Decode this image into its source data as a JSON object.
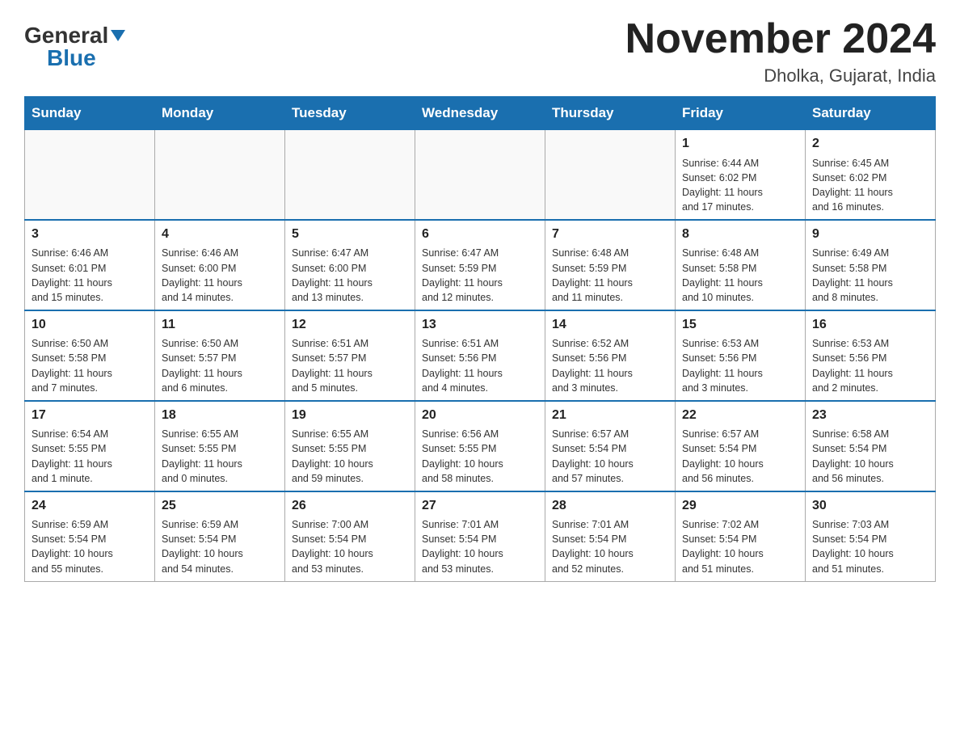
{
  "header": {
    "logo_text_general": "General",
    "logo_text_blue": "Blue",
    "month_title": "November 2024",
    "location": "Dholka, Gujarat, India"
  },
  "weekdays": [
    "Sunday",
    "Monday",
    "Tuesday",
    "Wednesday",
    "Thursday",
    "Friday",
    "Saturday"
  ],
  "weeks": [
    [
      {
        "day": "",
        "info": ""
      },
      {
        "day": "",
        "info": ""
      },
      {
        "day": "",
        "info": ""
      },
      {
        "day": "",
        "info": ""
      },
      {
        "day": "",
        "info": ""
      },
      {
        "day": "1",
        "info": "Sunrise: 6:44 AM\nSunset: 6:02 PM\nDaylight: 11 hours\nand 17 minutes."
      },
      {
        "day": "2",
        "info": "Sunrise: 6:45 AM\nSunset: 6:02 PM\nDaylight: 11 hours\nand 16 minutes."
      }
    ],
    [
      {
        "day": "3",
        "info": "Sunrise: 6:46 AM\nSunset: 6:01 PM\nDaylight: 11 hours\nand 15 minutes."
      },
      {
        "day": "4",
        "info": "Sunrise: 6:46 AM\nSunset: 6:00 PM\nDaylight: 11 hours\nand 14 minutes."
      },
      {
        "day": "5",
        "info": "Sunrise: 6:47 AM\nSunset: 6:00 PM\nDaylight: 11 hours\nand 13 minutes."
      },
      {
        "day": "6",
        "info": "Sunrise: 6:47 AM\nSunset: 5:59 PM\nDaylight: 11 hours\nand 12 minutes."
      },
      {
        "day": "7",
        "info": "Sunrise: 6:48 AM\nSunset: 5:59 PM\nDaylight: 11 hours\nand 11 minutes."
      },
      {
        "day": "8",
        "info": "Sunrise: 6:48 AM\nSunset: 5:58 PM\nDaylight: 11 hours\nand 10 minutes."
      },
      {
        "day": "9",
        "info": "Sunrise: 6:49 AM\nSunset: 5:58 PM\nDaylight: 11 hours\nand 8 minutes."
      }
    ],
    [
      {
        "day": "10",
        "info": "Sunrise: 6:50 AM\nSunset: 5:58 PM\nDaylight: 11 hours\nand 7 minutes."
      },
      {
        "day": "11",
        "info": "Sunrise: 6:50 AM\nSunset: 5:57 PM\nDaylight: 11 hours\nand 6 minutes."
      },
      {
        "day": "12",
        "info": "Sunrise: 6:51 AM\nSunset: 5:57 PM\nDaylight: 11 hours\nand 5 minutes."
      },
      {
        "day": "13",
        "info": "Sunrise: 6:51 AM\nSunset: 5:56 PM\nDaylight: 11 hours\nand 4 minutes."
      },
      {
        "day": "14",
        "info": "Sunrise: 6:52 AM\nSunset: 5:56 PM\nDaylight: 11 hours\nand 3 minutes."
      },
      {
        "day": "15",
        "info": "Sunrise: 6:53 AM\nSunset: 5:56 PM\nDaylight: 11 hours\nand 3 minutes."
      },
      {
        "day": "16",
        "info": "Sunrise: 6:53 AM\nSunset: 5:56 PM\nDaylight: 11 hours\nand 2 minutes."
      }
    ],
    [
      {
        "day": "17",
        "info": "Sunrise: 6:54 AM\nSunset: 5:55 PM\nDaylight: 11 hours\nand 1 minute."
      },
      {
        "day": "18",
        "info": "Sunrise: 6:55 AM\nSunset: 5:55 PM\nDaylight: 11 hours\nand 0 minutes."
      },
      {
        "day": "19",
        "info": "Sunrise: 6:55 AM\nSunset: 5:55 PM\nDaylight: 10 hours\nand 59 minutes."
      },
      {
        "day": "20",
        "info": "Sunrise: 6:56 AM\nSunset: 5:55 PM\nDaylight: 10 hours\nand 58 minutes."
      },
      {
        "day": "21",
        "info": "Sunrise: 6:57 AM\nSunset: 5:54 PM\nDaylight: 10 hours\nand 57 minutes."
      },
      {
        "day": "22",
        "info": "Sunrise: 6:57 AM\nSunset: 5:54 PM\nDaylight: 10 hours\nand 56 minutes."
      },
      {
        "day": "23",
        "info": "Sunrise: 6:58 AM\nSunset: 5:54 PM\nDaylight: 10 hours\nand 56 minutes."
      }
    ],
    [
      {
        "day": "24",
        "info": "Sunrise: 6:59 AM\nSunset: 5:54 PM\nDaylight: 10 hours\nand 55 minutes."
      },
      {
        "day": "25",
        "info": "Sunrise: 6:59 AM\nSunset: 5:54 PM\nDaylight: 10 hours\nand 54 minutes."
      },
      {
        "day": "26",
        "info": "Sunrise: 7:00 AM\nSunset: 5:54 PM\nDaylight: 10 hours\nand 53 minutes."
      },
      {
        "day": "27",
        "info": "Sunrise: 7:01 AM\nSunset: 5:54 PM\nDaylight: 10 hours\nand 53 minutes."
      },
      {
        "day": "28",
        "info": "Sunrise: 7:01 AM\nSunset: 5:54 PM\nDaylight: 10 hours\nand 52 minutes."
      },
      {
        "day": "29",
        "info": "Sunrise: 7:02 AM\nSunset: 5:54 PM\nDaylight: 10 hours\nand 51 minutes."
      },
      {
        "day": "30",
        "info": "Sunrise: 7:03 AM\nSunset: 5:54 PM\nDaylight: 10 hours\nand 51 minutes."
      }
    ]
  ]
}
